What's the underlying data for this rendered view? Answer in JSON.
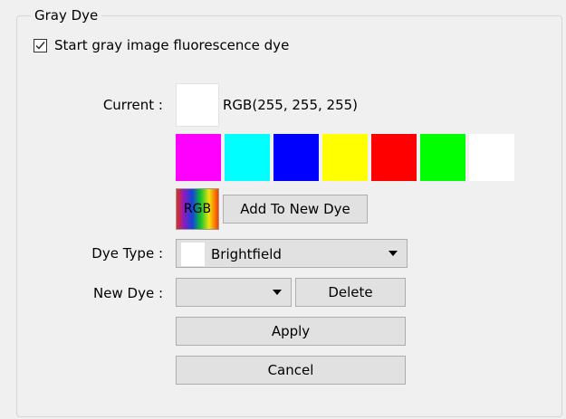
{
  "group": {
    "title": "Gray Dye"
  },
  "checkbox": {
    "label": "Start gray image fluorescence dye",
    "checked": true
  },
  "current": {
    "label": "Current :",
    "swatch_color": "#ffffff",
    "rgb_text": "RGB(255, 255, 255)"
  },
  "palette": [
    {
      "name": "magenta",
      "color": "#ff00ff"
    },
    {
      "name": "cyan",
      "color": "#00ffff"
    },
    {
      "name": "blue",
      "color": "#0000ff"
    },
    {
      "name": "yellow",
      "color": "#ffff00"
    },
    {
      "name": "red",
      "color": "#ff0000"
    },
    {
      "name": "green",
      "color": "#00ff00"
    },
    {
      "name": "white",
      "color": "#ffffff"
    }
  ],
  "rgb_button": {
    "label": "RGB"
  },
  "add_button": {
    "label": "Add To New Dye"
  },
  "dye_type": {
    "label": "Dye Type :",
    "value": "Brightfield",
    "chip_color": "#ffffff"
  },
  "new_dye": {
    "label": "New Dye :",
    "value": ""
  },
  "delete_button": {
    "label": "Delete"
  },
  "apply_button": {
    "label": "Apply"
  },
  "cancel_button": {
    "label": "Cancel"
  }
}
